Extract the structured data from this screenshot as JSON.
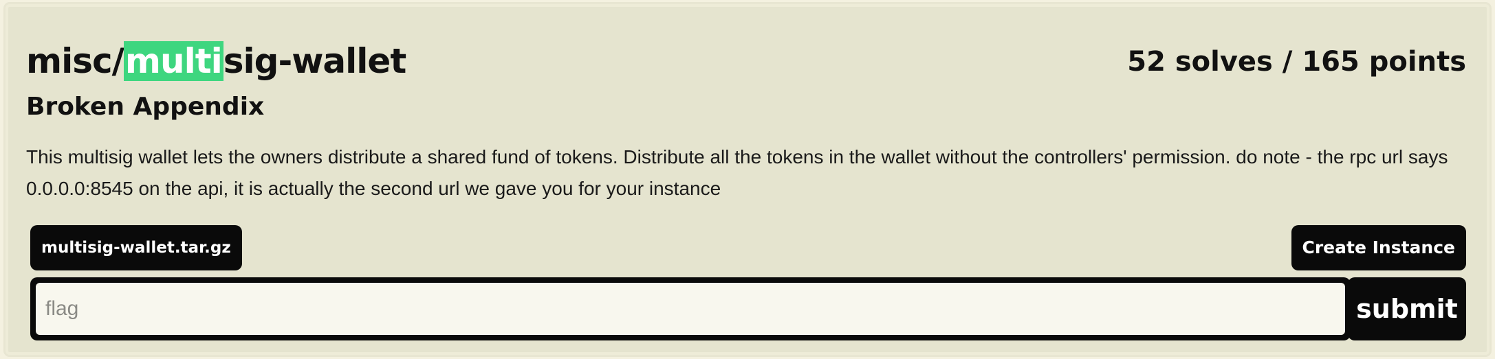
{
  "challenge": {
    "category": "misc/",
    "name_highlighted": "multi",
    "name_rest": "sig-wallet",
    "solves": "52 solves",
    "separator": " / ",
    "points": "165 points",
    "author": "Broken Appendix",
    "description": "This multisig wallet lets the owners distribute a shared fund of tokens. Distribute all the tokens in the wallet without the controllers' permission. do note - the rpc url says 0.0.0.0:8545 on the api, it is actually the second url we gave you for your instance"
  },
  "attachment": {
    "label": "multisig-wallet.tar.gz"
  },
  "instance": {
    "create_label": "Create Instance"
  },
  "flag_form": {
    "value": "",
    "placeholder": "flag",
    "submit_label": "submit"
  },
  "colors": {
    "highlight": "#3ed67f",
    "card_background": "#e5e4cf",
    "button_background": "#0a0a0a"
  }
}
